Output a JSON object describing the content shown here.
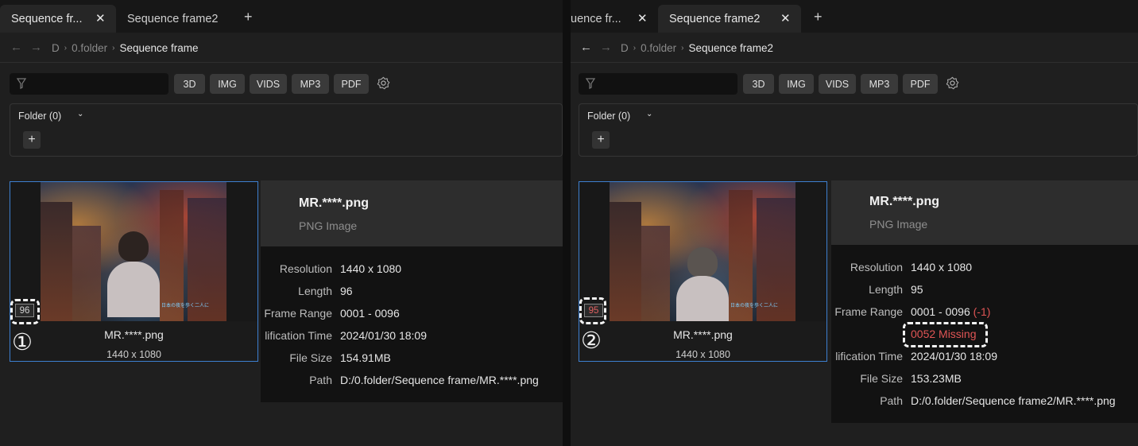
{
  "left": {
    "tabs": [
      {
        "label": "Sequence fr...",
        "active": true,
        "closable": true
      },
      {
        "label": "Sequence frame2",
        "active": false,
        "closable": false
      }
    ],
    "breadcrumb": [
      "D",
      "0.folder",
      "Sequence frame"
    ],
    "filters": [
      "3D",
      "IMG",
      "VIDS",
      "MP3",
      "PDF"
    ],
    "folder_label": "Folder (0)",
    "card": {
      "name": "MR.****.png",
      "resolution": "1440 x 1080",
      "frame_badge": "96",
      "annotation": "①"
    },
    "info": {
      "title": "MR.****.png",
      "type": "PNG Image",
      "labels": {
        "resolution": "Resolution",
        "length": "Length",
        "frame_range": "Frame Range",
        "mod_time": "lification Time",
        "file_size": "File Size",
        "path": "Path"
      },
      "values": {
        "resolution": "1440 x 1080",
        "length": "96",
        "frame_range": "0001 - 0096",
        "mod_time": "2024/01/30 18:09",
        "file_size": "154.91MB",
        "path": "D:/0.folder/Sequence frame/MR.****.png"
      }
    }
  },
  "right": {
    "tabs": [
      {
        "label": "uence fr...",
        "active": false,
        "closable": true
      },
      {
        "label": "Sequence frame2",
        "active": true,
        "closable": true
      }
    ],
    "breadcrumb": [
      "D",
      "0.folder",
      "Sequence frame2"
    ],
    "filters": [
      "3D",
      "IMG",
      "VIDS",
      "MP3",
      "PDF"
    ],
    "folder_label": "Folder (0)",
    "card": {
      "name": "MR.****.png",
      "resolution": "1440 x 1080",
      "frame_badge": "95",
      "annotation": "②"
    },
    "info": {
      "title": "MR.****.png",
      "type": "PNG Image",
      "labels": {
        "resolution": "Resolution",
        "length": "Length",
        "frame_range": "Frame Range",
        "mod_time": "lification Time",
        "file_size": "File Size",
        "path": "Path"
      },
      "values": {
        "resolution": "1440 x 1080",
        "length": "95",
        "frame_range": "0001 - 0096",
        "frame_range_diff": "(-1)",
        "missing": "0052 Missing",
        "mod_time": "2024/01/30 18:09",
        "file_size": "153.23MB",
        "path": "D:/0.folder/Sequence frame2/MR.****.png"
      }
    }
  },
  "thumbnail_caption": "日本の夜を歩く二人に",
  "colors": {
    "selection_border": "#3d7fd0",
    "missing_red": "#e05555",
    "pane_bg": "#1f1f1f"
  },
  "icons": [
    "close-icon",
    "plus-icon",
    "back-arrow-icon",
    "forward-arrow-icon",
    "chevron-right-icon",
    "filter-icon",
    "gear-icon",
    "chevron-down-icon"
  ]
}
